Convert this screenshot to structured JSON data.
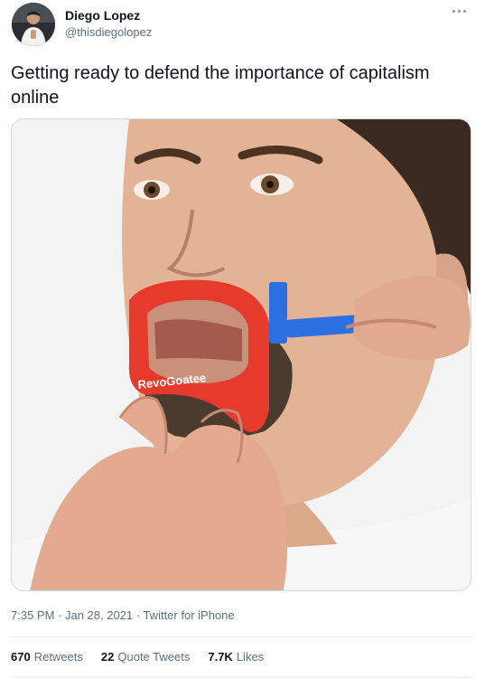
{
  "user": {
    "name": "Diego Lopez",
    "handle": "@thisdiegolopez"
  },
  "tweet": {
    "text": "Getting ready to defend the importance of capitalism online",
    "timestamp": "7:35 PM · Jan 28, 2021 · Twitter for iPhone",
    "image_text": "RevoGoatee"
  },
  "stats": {
    "retweets_count": "670",
    "retweets_label": "Retweets",
    "quotes_count": "22",
    "quotes_label": "Quote Tweets",
    "likes_count": "7.7K",
    "likes_label": "Likes"
  },
  "icons": {
    "more": "more-options-icon"
  },
  "colors": {
    "secondary_text": "#5b7083",
    "primary_text": "#0f1419",
    "divider": "#e6ecf0",
    "guide_red": "#e53a2c",
    "razor_blue": "#2c6fe0"
  }
}
